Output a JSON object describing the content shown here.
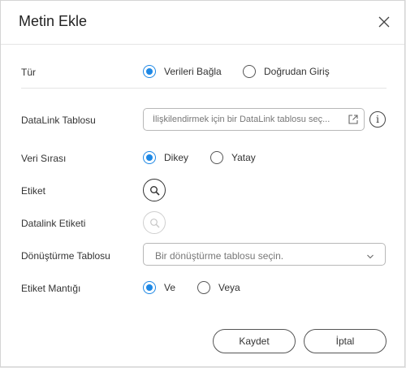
{
  "dialog": {
    "title": "Metin Ekle",
    "close_icon": "close-icon"
  },
  "fields": {
    "type": {
      "label": "Tür",
      "options": [
        "Verileri Bağla",
        "Doğrudan Giriş"
      ],
      "selected": "Verileri Bağla"
    },
    "datalink_table": {
      "label": "DataLink Tablosu",
      "placeholder": "İlişkilendirmek için bir DataLink tablosu seç...",
      "icon": "external-link-icon",
      "info_icon": "info-icon",
      "info_symbol": "i"
    },
    "data_order": {
      "label": "Veri Sırası",
      "options": [
        "Dikey",
        "Yatay"
      ],
      "selected": "Dikey"
    },
    "label_field": {
      "label": "Etiket",
      "icon": "search-icon"
    },
    "datalink_label": {
      "label": "Datalink Etiketi",
      "icon": "search-icon",
      "disabled": true
    },
    "conversion_table": {
      "label": "Dönüştürme Tablosu",
      "placeholder": "Bir dönüştürme tablosu seçin.",
      "icon": "chevron-down-icon"
    },
    "label_logic": {
      "label": "Etiket Mantığı",
      "options": [
        "Ve",
        "Veya"
      ],
      "selected": "Ve"
    }
  },
  "buttons": {
    "save": "Kaydet",
    "cancel": "İptal"
  },
  "colors": {
    "accent": "#1e88e5"
  }
}
